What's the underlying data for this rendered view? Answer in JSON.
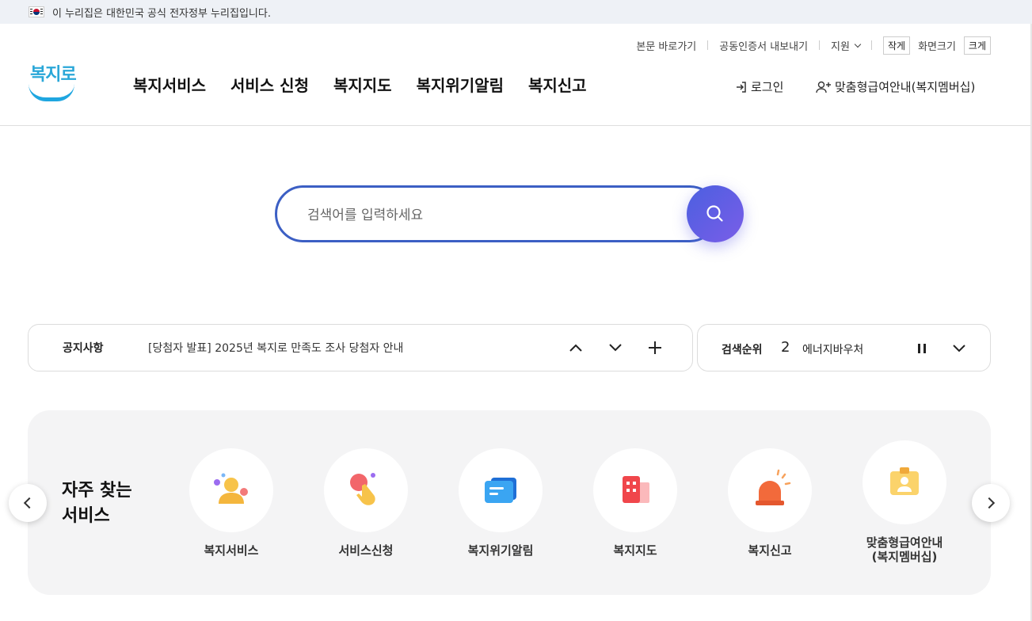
{
  "gov_banner": {
    "text": "이 누리집은 대한민국 공식 전자정부 누리집입니다."
  },
  "utility": {
    "skip_to_content": "본문 바로가기",
    "export_cert": "공동인증서 내보내기",
    "support": "지원",
    "smaller": "작게",
    "screen_size": "화면크기",
    "larger": "크게"
  },
  "logo": {
    "text": "복지로"
  },
  "gnb": {
    "items": [
      "복지서비스",
      "서비스 신청",
      "복지지도",
      "복지위기알림",
      "복지신고"
    ]
  },
  "header": {
    "login": "로그인",
    "membership": "맞춤형급여안내(복지멤버십)"
  },
  "search": {
    "placeholder": "검색어를 입력하세요"
  },
  "notice": {
    "title": "공지사항",
    "text": "[당첨자 발표] 2025년 복지로 만족도 조사 당첨자 안내"
  },
  "search_rank": {
    "title": "검색순위",
    "rank": "2",
    "term": "에너지바우처"
  },
  "frequent_services": {
    "title_line1": "자주 찾는",
    "title_line2": "서비스",
    "items": [
      {
        "label": "복지서비스",
        "icon": "person-icon"
      },
      {
        "label": "서비스신청",
        "icon": "hand-tap-icon"
      },
      {
        "label": "복지위기알림",
        "icon": "message-icon"
      },
      {
        "label": "복지지도",
        "icon": "building-icon"
      },
      {
        "label": "복지신고",
        "icon": "siren-icon"
      },
      {
        "label": "맞춤형급여안내",
        "label2": "(복지멤버십)",
        "icon": "id-card-icon"
      }
    ]
  },
  "colors": {
    "accent": "#3c5fc4",
    "brand": "#1fa6e0",
    "search_button": "#5b5fe4"
  }
}
